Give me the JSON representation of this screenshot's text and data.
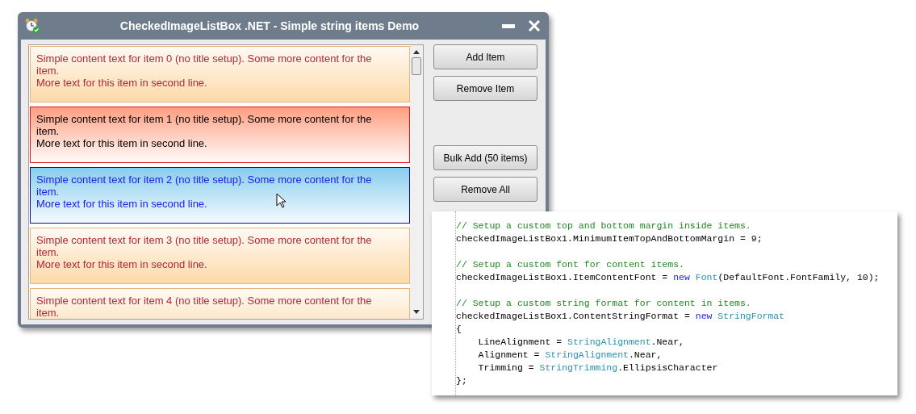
{
  "window": {
    "title": "CheckedImageListBox .NET - Simple string items Demo"
  },
  "items": [
    {
      "kind": "normal",
      "text": "Simple content text for item 0 (no title setup). Some more content for the item.",
      "second_line": "More text for this item in second line."
    },
    {
      "kind": "hot",
      "text": "Simple content text for item 1 (no title setup). Some more content for the item.",
      "second_line": "More text for this item in second line."
    },
    {
      "kind": "selected",
      "text": "Simple content text for item 2 (no title setup). Some more content for the item.",
      "second_line": "More text for this item in second line."
    },
    {
      "kind": "normal",
      "text": "Simple content text for item 3 (no title setup). Some more content for the item.",
      "second_line": "More text for this item in second line."
    },
    {
      "kind": "normal",
      "text": "Simple content text for item 4 (no title setup). Some more content for the item."
    }
  ],
  "buttons": [
    {
      "label": "Add Item"
    },
    {
      "label": "Remove Item"
    },
    {
      "label": "Bulk Add (50 items)"
    },
    {
      "label": "Remove All"
    }
  ],
  "code_blocks": [
    [
      [
        {
          "kind": "comment",
          "text": "// Setup a custom top and bottom margin inside items."
        }
      ],
      [
        {
          "kind": "plain",
          "text": "checkedImageListBox1.MinimumItemTopAndBottomMargin = 9;"
        }
      ]
    ],
    [
      [
        {
          "kind": "comment",
          "text": "// Setup a custom font for content items."
        }
      ],
      [
        {
          "kind": "plain",
          "text": "checkedImageListBox1.ItemContentFont = "
        },
        {
          "kind": "keyword",
          "text": "new "
        },
        {
          "kind": "type",
          "text": "Font"
        },
        {
          "kind": "plain",
          "text": "(DefaultFont.FontFamily, 10);"
        }
      ]
    ],
    [
      [
        {
          "kind": "comment",
          "text": "// Setup a custom string format for content in items."
        }
      ],
      [
        {
          "kind": "plain",
          "text": "checkedImageListBox1.ContentStringFormat = "
        },
        {
          "kind": "keyword",
          "text": "new "
        },
        {
          "kind": "type",
          "text": "StringFormat"
        }
      ],
      [
        {
          "kind": "plain",
          "text": "{"
        }
      ],
      [
        {
          "kind": "plain",
          "text": "    LineAlignment = "
        },
        {
          "kind": "type",
          "text": "StringAlignment"
        },
        {
          "kind": "plain",
          "text": ".Near,"
        }
      ],
      [
        {
          "kind": "plain",
          "text": "    Alignment = "
        },
        {
          "kind": "type",
          "text": "StringAlignment"
        },
        {
          "kind": "plain",
          "text": ".Near,"
        }
      ],
      [
        {
          "kind": "plain",
          "text": "    Trimming = "
        },
        {
          "kind": "type",
          "text": "StringTrimming"
        },
        {
          "kind": "plain",
          "text": ".EllipsisCharacter"
        }
      ],
      [
        {
          "kind": "plain",
          "text": "};"
        }
      ]
    ]
  ]
}
